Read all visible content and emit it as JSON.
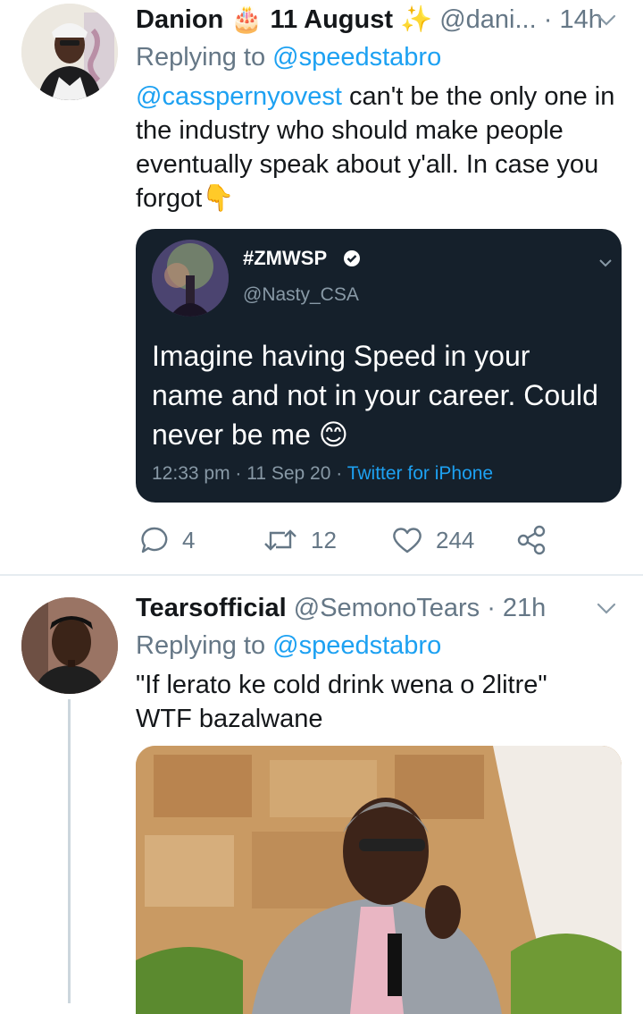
{
  "tweets": [
    {
      "name": "Danion 🎂 11 August ✨",
      "handle": "@dani...",
      "time": "· 14h",
      "replying_prefix": "Replying to ",
      "replying_to": "@speedstabro",
      "mention": "@casspernyovest",
      "text": " can't be the only one in the industry who should make people eventually speak about y'all. In case you forgot👇",
      "quote": {
        "name": "#ZMWSP",
        "handle": "@Nasty_CSA",
        "text": "Imagine having Speed in your name and not in your career. Could never be me 😊",
        "meta": "12:33 pm · 11 Sep 20 · ",
        "source": "Twitter for iPhone"
      },
      "actions": {
        "replies": "4",
        "retweets": "12",
        "likes": "244"
      }
    },
    {
      "name": "Tearsofficial",
      "handle": "@SemonoTears",
      "time": "· 21h",
      "replying_prefix": "Replying to ",
      "replying_to": "@speedstabro",
      "text_line1": "\"If lerato ke cold drink wena o 2litre\"",
      "text_line2": "WTF bazalwane"
    }
  ],
  "colors": {
    "link": "#1da1f2",
    "muted": "#657786",
    "quote_bg": "#15202b"
  },
  "icons": [
    "reply-icon",
    "retweet-icon",
    "like-icon",
    "share-icon",
    "chevron-down-icon",
    "verified-badge-icon"
  ]
}
